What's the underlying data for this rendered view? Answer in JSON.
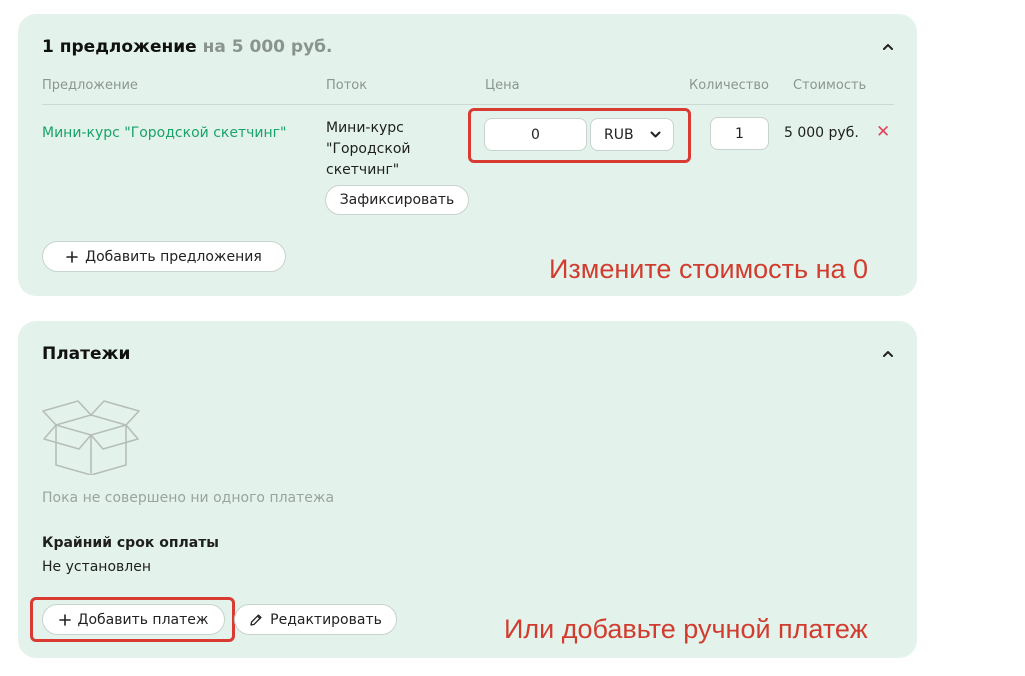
{
  "offers": {
    "title": "1 предложение",
    "title_sum": "на 5 000 руб.",
    "columns": [
      "Предложение",
      "Поток",
      "Цена",
      "Количество",
      "Стоимость"
    ],
    "row": {
      "offer": "Мини-курс \"Городской скетчинг\"",
      "stream": "Мини-курс\n\"Городской\nскетчинг\"",
      "fix_button": "Зафиксировать",
      "price": "0",
      "currency": "RUB",
      "quantity": "1",
      "cost": "5 000 руб."
    },
    "add_offer_button": "Добавить предложения",
    "annotation": "Измените стоимость на 0"
  },
  "payments": {
    "title": "Платежи",
    "empty_text": "Пока не совершено ни одного платежа",
    "deadline_label": "Крайний срок оплаты",
    "deadline_value": "Не установлен",
    "add_payment_button": "Добавить платеж",
    "edit_button": "Редактировать",
    "annotation": "Или добавьте ручной платеж"
  },
  "colors": {
    "card_bg": "#e3f3ec",
    "link": "#19a36a",
    "highlight": "#d93a32",
    "remove": "#e0455a"
  },
  "icons": [
    "chevron-up-icon",
    "chevron-down-icon",
    "close-icon",
    "plus-icon",
    "empty-box-icon",
    "pencil-icon"
  ]
}
